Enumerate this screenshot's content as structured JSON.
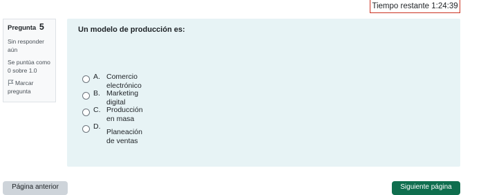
{
  "timer": {
    "label": "Tiempo restante",
    "value": "1:24:39"
  },
  "question_info": {
    "label": "Pregunta",
    "number": "5",
    "status": "Sin responder aún",
    "score": "Se puntúa como 0 sobre 1.0",
    "flag_label": "Marcar pregunta"
  },
  "question": {
    "text": "Un modelo de producción es:",
    "answers": [
      {
        "letter": "A.",
        "label": "Comercio electrónico"
      },
      {
        "letter": "B.",
        "label": "Marketing digital"
      },
      {
        "letter": "C.",
        "label": "Producción en masa"
      },
      {
        "letter": "D.",
        "label": "Planeación de ventas"
      }
    ]
  },
  "nav": {
    "prev_label": "Página anterior",
    "next_label": "Siguiente página"
  },
  "colors": {
    "timer_border": "#ca3120",
    "content_bg": "#e7f3f5",
    "next_button": "#0f6e4e",
    "prev_button": "#ced4da"
  }
}
